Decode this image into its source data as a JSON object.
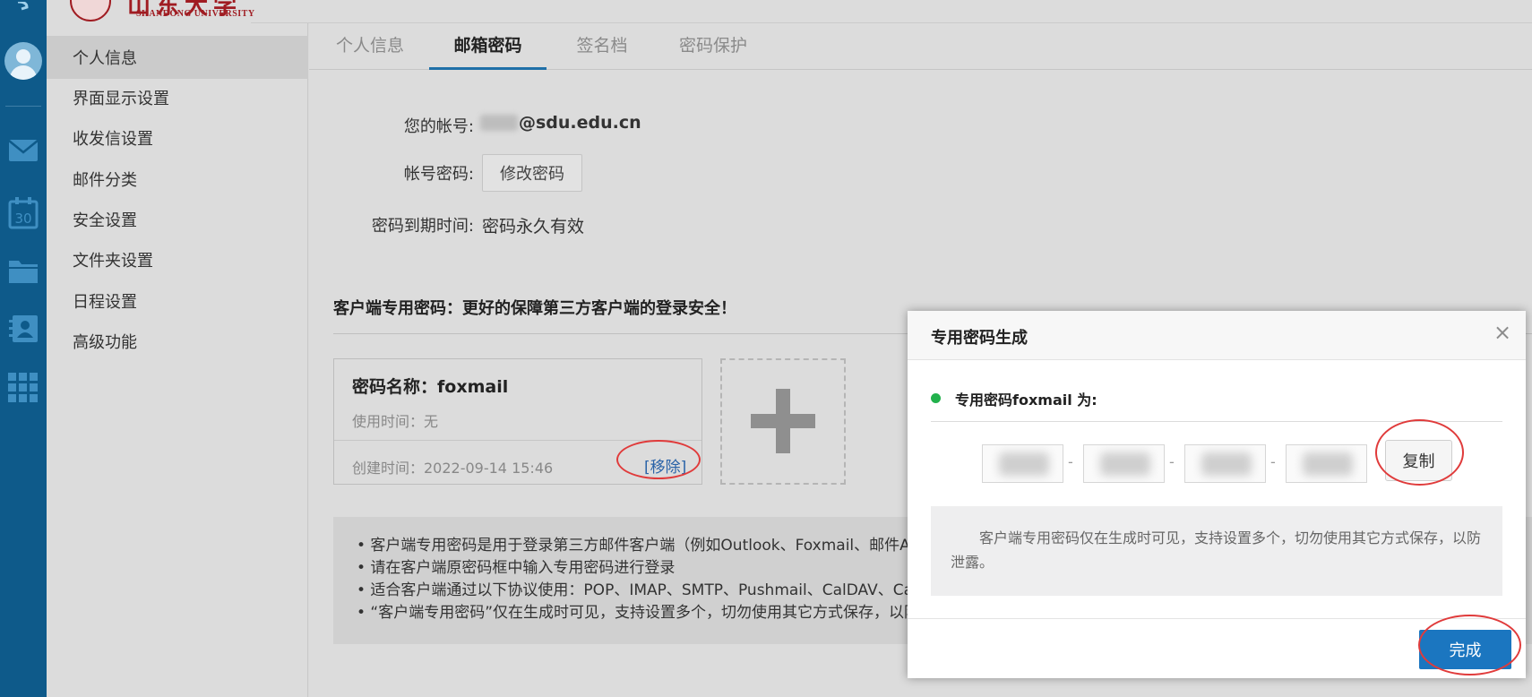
{
  "logo": {
    "cn": "山东大学",
    "en": "SHANDONG UNIVERSITY"
  },
  "iconbar": {
    "icons": [
      "compose-icon",
      "avatar-icon",
      "mail-icon",
      "calendar-icon",
      "folder-icon",
      "contacts-icon",
      "apps-grid-icon"
    ],
    "calendar_day": "30"
  },
  "settings_nav": {
    "items": [
      {
        "label": "个人信息",
        "active": true
      },
      {
        "label": "界面显示设置",
        "active": false
      },
      {
        "label": "收发信设置",
        "active": false
      },
      {
        "label": "邮件分类",
        "active": false
      },
      {
        "label": "安全设置",
        "active": false
      },
      {
        "label": "文件夹设置",
        "active": false
      },
      {
        "label": "日程设置",
        "active": false
      },
      {
        "label": "高级功能",
        "active": false
      }
    ]
  },
  "tabs": [
    {
      "label": "个人信息",
      "active": false
    },
    {
      "label": "邮箱密码",
      "active": true
    },
    {
      "label": "签名档",
      "active": false
    },
    {
      "label": "密码保护",
      "active": false
    }
  ],
  "account": {
    "account_label": "您的帐号:",
    "account_value": "@sdu.edu.cn",
    "password_label": "帐号密码:",
    "change_password_button": "修改密码",
    "expire_label": "密码到期时间:",
    "expire_value": "密码永久有效"
  },
  "client_password": {
    "section_title": "客户端专用密码：更好的保障第三方客户端的登录安全！",
    "card": {
      "name": "密码名称：foxmail",
      "used": "使用时间：无",
      "created": "创建时间：2022-09-14 15:46",
      "remove": "[移除]"
    },
    "notes": [
      "• 客户端专用密码是用于登录第三方邮件客户端（例如Outlook、Foxmail、邮件App",
      "• 请在客户端原密码框中输入专用密码进行登录",
      "• 适合客户端通过以下协议使用：POP、IMAP、SMTP、Pushmail、CalDAV、Card",
      "• “客户端专用密码”仅在生成时可见，支持设置多个，切勿使用其它方式保存，以防"
    ]
  },
  "modal": {
    "title": "专用密码生成",
    "close": "×",
    "subtitle": "专用密码foxmail 为:",
    "dash": "-",
    "copy_button": "复制",
    "tip": "客户端专用密码仅在生成时可见，支持设置多个，切勿使用其它方式保存，以防泄露。",
    "done_button": "完成"
  },
  "colors": {
    "sidebar": "#0e5a8a",
    "accent": "#1b76c0",
    "highlight_circle": "#e03b3b",
    "status_dot": "#22b14c"
  }
}
